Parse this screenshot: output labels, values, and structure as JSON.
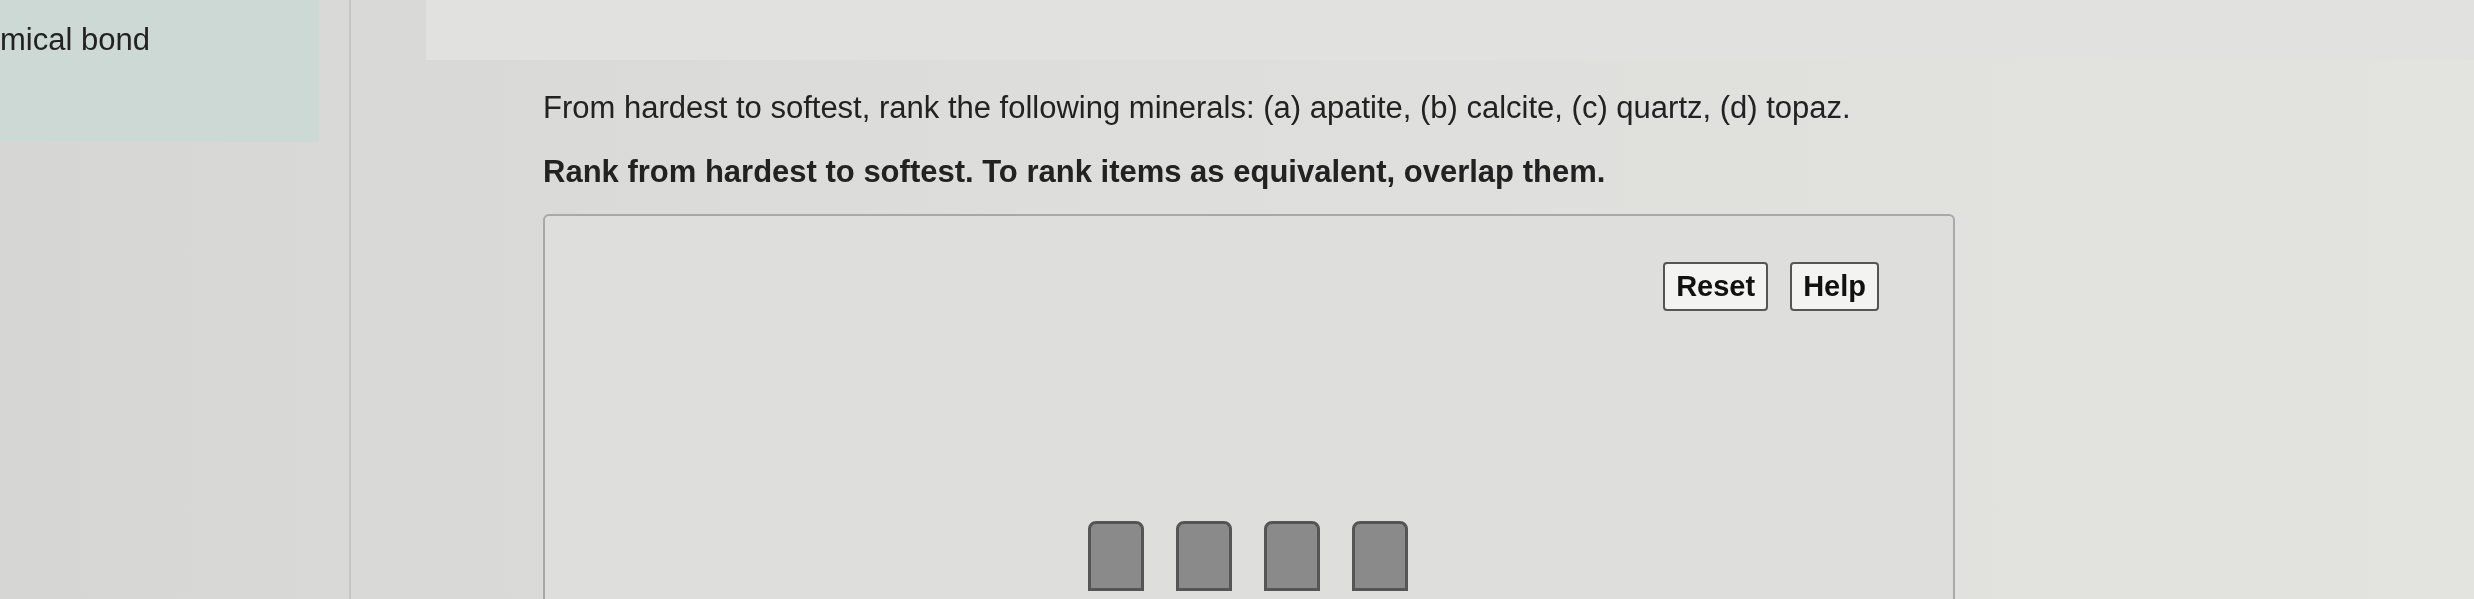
{
  "sidebar": {
    "item": "mical bond"
  },
  "question": {
    "prompt": "From hardest to softest, rank the following minerals: (a) apatite, (b) calcite, (c) quartz, (d) topaz.",
    "instruction": "Rank from hardest to softest. To rank items as equivalent, overlap them."
  },
  "ranking_area": {
    "buttons": [
      "Reset",
      "Help"
    ],
    "items": [
      {
        "kind": "tile"
      },
      {
        "kind": "tile"
      },
      {
        "kind": "tile"
      },
      {
        "kind": "tile"
      }
    ]
  }
}
